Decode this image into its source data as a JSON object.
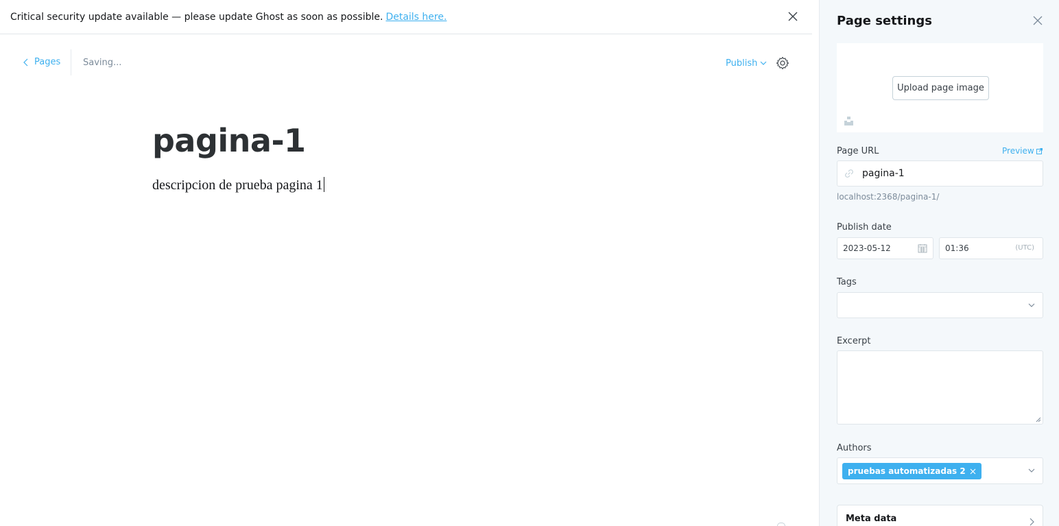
{
  "banner": {
    "message": "Critical security update available — please update Ghost as soon as possible.",
    "link_text": "Details here."
  },
  "topbar": {
    "back_label": "Pages",
    "status": "Saving...",
    "publish_label": "Publish"
  },
  "editor": {
    "title": "pagina-1",
    "body": "descripcion de prueba pagina 1"
  },
  "settings": {
    "title": "Page settings",
    "upload_image_label": "Upload page image",
    "page_url_label": "Page URL",
    "preview_label": "Preview",
    "slug_value": "pagina-1",
    "url_hint": "localhost:2368/pagina-1/",
    "publish_date_label": "Publish date",
    "date_value": "2023-05-12",
    "time_value": "01:36",
    "timezone": "(UTC)",
    "tags_label": "Tags",
    "excerpt_label": "Excerpt",
    "authors_label": "Authors",
    "authors": [
      "pruebas automatizadas 2"
    ],
    "meta_data_label": "Meta data"
  },
  "colors": {
    "accent": "#3eb0ef",
    "panel_bg": "#f4f8fb",
    "border": "#dfe5ea",
    "muted_text": "#7c8b9a"
  }
}
